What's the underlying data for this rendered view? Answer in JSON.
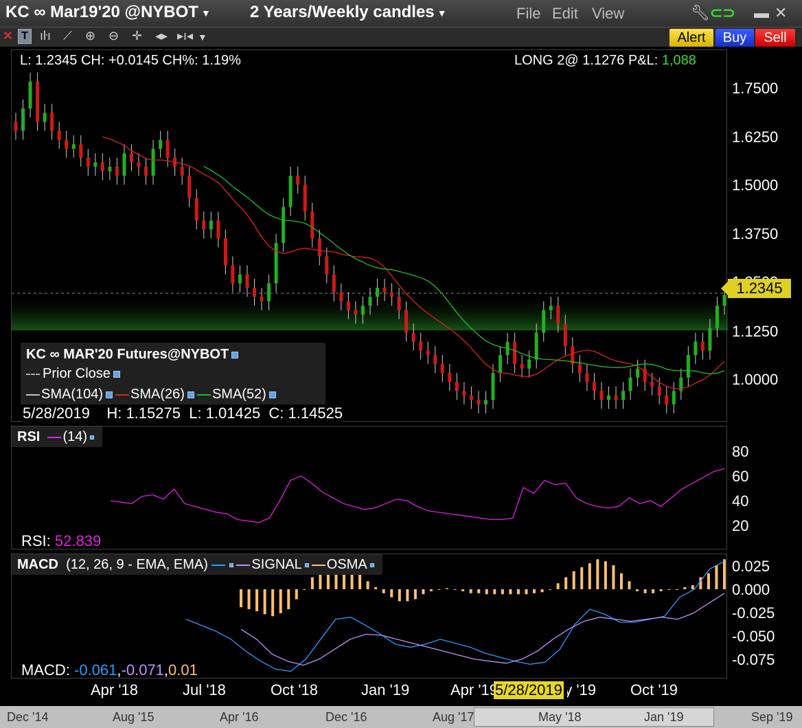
{
  "window": {
    "title": "KC ∞ Mar19'20 @NYBOT",
    "timeframe": "2 Years/Weekly candles",
    "menus": [
      "File",
      "Edit",
      "View"
    ]
  },
  "actions": {
    "alert": "Alert",
    "buy": "Buy",
    "sell": "Sell"
  },
  "quote": {
    "last_label": "L:",
    "last": "1.2345",
    "ch_label": "CH:",
    "ch": "+0.0145",
    "chp_label": "CH%:",
    "chp": "1.19%"
  },
  "position": {
    "text": "LONG 2@ 1.1276",
    "pnl_label": "P&L:",
    "pnl": "1,088"
  },
  "legend": {
    "title": "KC ∞ MAR'20 Futures@NYBOT",
    "prior_close": "Prior Close",
    "sma104": "SMA(104)",
    "sma26": "SMA(26)",
    "sma52": "SMA(52)"
  },
  "hover": {
    "date": "5/28/2019",
    "high": "H: 1.15275",
    "low": "L: 1.01425",
    "close": "C: 1.14525"
  },
  "price_tag": "1.2345",
  "price_axis": [
    "1.7500",
    "1.6250",
    "1.5000",
    "1.3750",
    "1.2500",
    "1.1250",
    "1.0000"
  ],
  "rsi": {
    "label": "RSI",
    "period": "(14)",
    "readout_label": "RSI:",
    "readout": "52.839",
    "axis": [
      "80",
      "60",
      "40",
      "20"
    ]
  },
  "macd": {
    "label": "MACD",
    "params": "(12, 26, 9 - EMA, EMA)",
    "signal": "SIGNAL",
    "osma": "OSMA",
    "readout_label": "MACD:",
    "readout_a": "-0.061",
    "readout_b": "-0.071",
    "readout_c": "0.01",
    "axis": [
      "0.025",
      "0.000",
      "-0.025",
      "-0.050",
      "-0.075"
    ]
  },
  "time_axis": [
    "Apr '18",
    "Jul '18",
    "Oct '18",
    "Jan '19",
    "Apr '19",
    "May '19",
    "Oct '19"
  ],
  "time_cursor": "5/28/2019",
  "navigator": [
    "Dec '14",
    "Aug '15",
    "Apr '16",
    "Dec '16",
    "Aug '17",
    "May '18",
    "Jan '19",
    "Sep '19"
  ],
  "colors": {
    "sma26": "#e02020",
    "sma52": "#20c020",
    "sma104": "#c0c0c0",
    "rsi": "#e020e0",
    "macd": "#2a9bff",
    "signal": "#c090ff",
    "osma": "#ffc070",
    "up": "#20b020",
    "down": "#d01818"
  },
  "chart_data": [
    {
      "type": "candlestick",
      "title": "KC ∞ MAR'20 Futures@NYBOT",
      "ylim": [
        0.95,
        1.78
      ],
      "close": [
        1.6,
        1.65,
        1.71,
        1.62,
        1.64,
        1.6,
        1.58,
        1.56,
        1.57,
        1.54,
        1.52,
        1.53,
        1.51,
        1.52,
        1.5,
        1.55,
        1.53,
        1.52,
        1.5,
        1.56,
        1.58,
        1.54,
        1.52,
        1.5,
        1.45,
        1.4,
        1.38,
        1.4,
        1.36,
        1.3,
        1.26,
        1.28,
        1.25,
        1.23,
        1.22,
        1.26,
        1.35,
        1.43,
        1.5,
        1.48,
        1.42,
        1.36,
        1.32,
        1.28,
        1.24,
        1.22,
        1.2,
        1.19,
        1.21,
        1.23,
        1.25,
        1.24,
        1.23,
        1.2,
        1.15,
        1.13,
        1.11,
        1.1,
        1.08,
        1.06,
        1.04,
        1.02,
        1.01,
        1.0,
        0.99,
        1.0,
        1.06,
        1.1,
        1.13,
        1.08,
        1.07,
        1.09,
        1.15,
        1.2,
        1.21,
        1.17,
        1.12,
        1.08,
        1.06,
        1.04,
        1.02,
        1.0,
        1.01,
        1.0,
        1.02,
        1.05,
        1.07,
        1.04,
        1.03,
        1.01,
        0.99,
        1.02,
        1.05,
        1.1,
        1.13,
        1.11,
        1.16,
        1.21,
        1.2345
      ]
    },
    {
      "type": "line",
      "title": "RSI",
      "ylim": [
        10,
        95
      ],
      "values": [
        44,
        43,
        42,
        47,
        48,
        45,
        52,
        42,
        40,
        38,
        36,
        35,
        31,
        30,
        29,
        32,
        44,
        58,
        61,
        56,
        50,
        46,
        42,
        40,
        38,
        39,
        42,
        45,
        44,
        40,
        37,
        36,
        35,
        34,
        33,
        32,
        31,
        31,
        32,
        53,
        49,
        58,
        55,
        56,
        46,
        42,
        40,
        39,
        40,
        46,
        42,
        44,
        40,
        46,
        52,
        56,
        60,
        64,
        66
      ]
    },
    {
      "type": "bar",
      "title": "MACD",
      "ylim": [
        -0.09,
        0.035
      ],
      "osma": [
        -0.018,
        -0.02,
        -0.022,
        -0.025,
        -0.027,
        -0.024,
        -0.02,
        -0.01,
        0.0,
        0.012,
        0.02,
        0.025,
        0.03,
        0.028,
        0.022,
        0.015,
        0.008,
        0.002,
        -0.004,
        -0.008,
        -0.012,
        -0.012,
        -0.01,
        -0.005,
        -0.002,
        0.0,
        0.001,
        0.0,
        -0.002,
        -0.004,
        -0.004,
        -0.005,
        -0.005,
        -0.005,
        -0.005,
        -0.005,
        -0.005,
        -0.004,
        -0.003,
        0.0,
        0.006,
        0.012,
        0.018,
        0.022,
        0.026,
        0.03,
        0.028,
        0.024,
        0.016,
        0.008,
        -0.002,
        -0.004,
        -0.004,
        -0.002,
        0.0,
        0.0,
        0.002,
        0.004,
        0.012,
        0.016,
        0.024,
        0.03
      ],
      "macd": [
        -0.03,
        -0.036,
        -0.042,
        -0.05,
        -0.062,
        -0.072,
        -0.08,
        -0.082,
        -0.07,
        -0.05,
        -0.03,
        -0.028,
        -0.036,
        -0.045,
        -0.055,
        -0.058,
        -0.055,
        -0.05,
        -0.054,
        -0.058,
        -0.064,
        -0.068,
        -0.072,
        -0.075,
        -0.073,
        -0.06,
        -0.035,
        -0.02,
        -0.025,
        -0.033,
        -0.033,
        -0.03,
        -0.027,
        -0.008,
        0.0,
        0.02,
        0.028
      ],
      "signal": [
        -0.04,
        -0.05,
        -0.065,
        -0.072,
        -0.076,
        -0.07,
        -0.06,
        -0.05,
        -0.045,
        -0.046,
        -0.05,
        -0.054,
        -0.058,
        -0.062,
        -0.066,
        -0.07,
        -0.072,
        -0.074,
        -0.07,
        -0.062,
        -0.05,
        -0.04,
        -0.032,
        -0.028,
        -0.03,
        -0.032,
        -0.03,
        -0.028,
        -0.03,
        -0.024,
        -0.014,
        -0.004
      ]
    }
  ]
}
